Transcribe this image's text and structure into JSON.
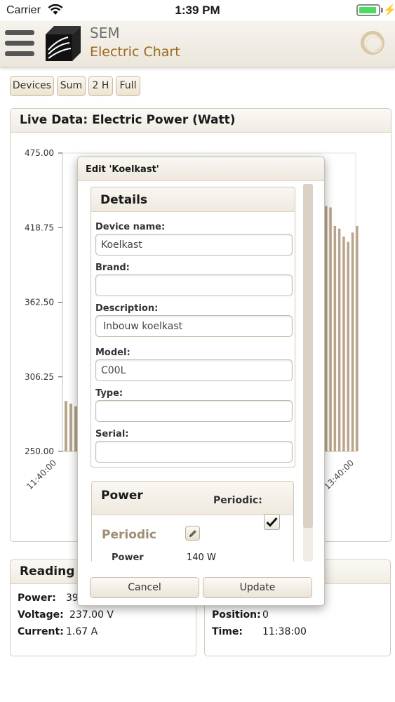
{
  "status": {
    "carrier": "Carrier",
    "time": "1:39 PM",
    "battery_level": 0.92
  },
  "header": {
    "app_name": "SEM",
    "page_title": "Electric Chart"
  },
  "toolbar": {
    "buttons": [
      "Devices",
      "Sum",
      "2 H",
      "Full"
    ]
  },
  "live_panel": {
    "title": "Live Data: Electric Power (Watt)"
  },
  "chart_data": {
    "type": "bar",
    "y_ticks": [
      "475.00",
      "418.75",
      "362.50",
      "306.25",
      "250.00"
    ],
    "ylim": [
      250,
      475
    ],
    "x_ticks": [
      "11:40:00",
      "13:40:00"
    ],
    "series_color": "#b9a58a",
    "left_bars": [
      288,
      286,
      284,
      282,
      283,
      282
    ],
    "right_bars": [
      435,
      434,
      420,
      418,
      412,
      408,
      415,
      420
    ]
  },
  "readings": {
    "title": "Reading",
    "power_label": "Power:",
    "power_value": "39",
    "voltage_label": "Voltage:",
    "voltage_value": "237.00 V",
    "current_label": "Current:",
    "current_value": "1.67 A"
  },
  "position_panel": {
    "position_label": "Position:",
    "position_value": "0",
    "time_label": "Time:",
    "time_value": "11:38:00"
  },
  "dialog": {
    "title": "Edit 'Koelkast'",
    "details": {
      "title": "Details",
      "device_name_label": "Device name:",
      "device_name_value": "Koelkast",
      "brand_label": "Brand:",
      "brand_value": "",
      "description_label": "Description:",
      "description_value": "Inbouw koelkast",
      "model_label": "Model:",
      "model_value": "C00L",
      "type_label": "Type:",
      "type_value": "",
      "serial_label": "Serial:",
      "serial_value": ""
    },
    "power": {
      "title": "Power",
      "periodic_label": "Periodic:",
      "periodic_checked": true,
      "periodic_heading": "Periodic",
      "power_label": "Power",
      "power_value": "140 W"
    },
    "cancel_label": "Cancel",
    "update_label": "Update"
  }
}
